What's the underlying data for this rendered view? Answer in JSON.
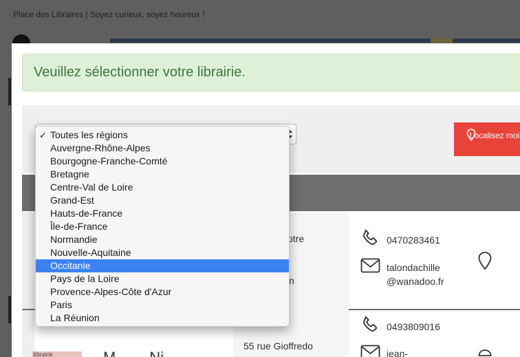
{
  "page": {
    "tagline": "Place des Libraires | Soyez curieux, soyez heureux !"
  },
  "modal": {
    "alert_text": "Veuillez sélectionner votre librairie.",
    "locate_button": "Localisez moi"
  },
  "region_select": {
    "current": "Toutes les régions",
    "options": [
      {
        "label": "Toutes les régions",
        "checked": true
      },
      {
        "label": "Auvergne-Rhône-Alpes"
      },
      {
        "label": "Bourgogne-Franche-Comté"
      },
      {
        "label": "Bretagne"
      },
      {
        "label": "Centre-Val de Loire"
      },
      {
        "label": "Grand-Est"
      },
      {
        "label": "Hauts-de-France"
      },
      {
        "label": "Île-de-France"
      },
      {
        "label": "Normandie"
      },
      {
        "label": "Nouvelle-Aquitaine"
      },
      {
        "label": "Occitanie",
        "highlighted": true
      },
      {
        "label": "Pays de la Loire"
      },
      {
        "label": "Provence-Alpes-Côte d'Azur"
      },
      {
        "label": "Paris"
      },
      {
        "label": "La Réunion"
      }
    ]
  },
  "results": [
    {
      "address_fragment_1": "otre",
      "address_fragment_2": "n",
      "phone": "0470283461",
      "email_line1": "talondachille",
      "email_line2": "@wanadoo.fr"
    },
    {
      "thumb_text": "librairie",
      "name_fragment": "M... ... Ni...",
      "address": "55 rue Gioffredo",
      "phone": "0493809016",
      "email_line1": "jean-"
    }
  ],
  "colors": {
    "alert_bg": "#dff0d8",
    "alert_text": "#3c763d",
    "locate_button": "#e8443a",
    "highlight": "#3b82f0"
  }
}
